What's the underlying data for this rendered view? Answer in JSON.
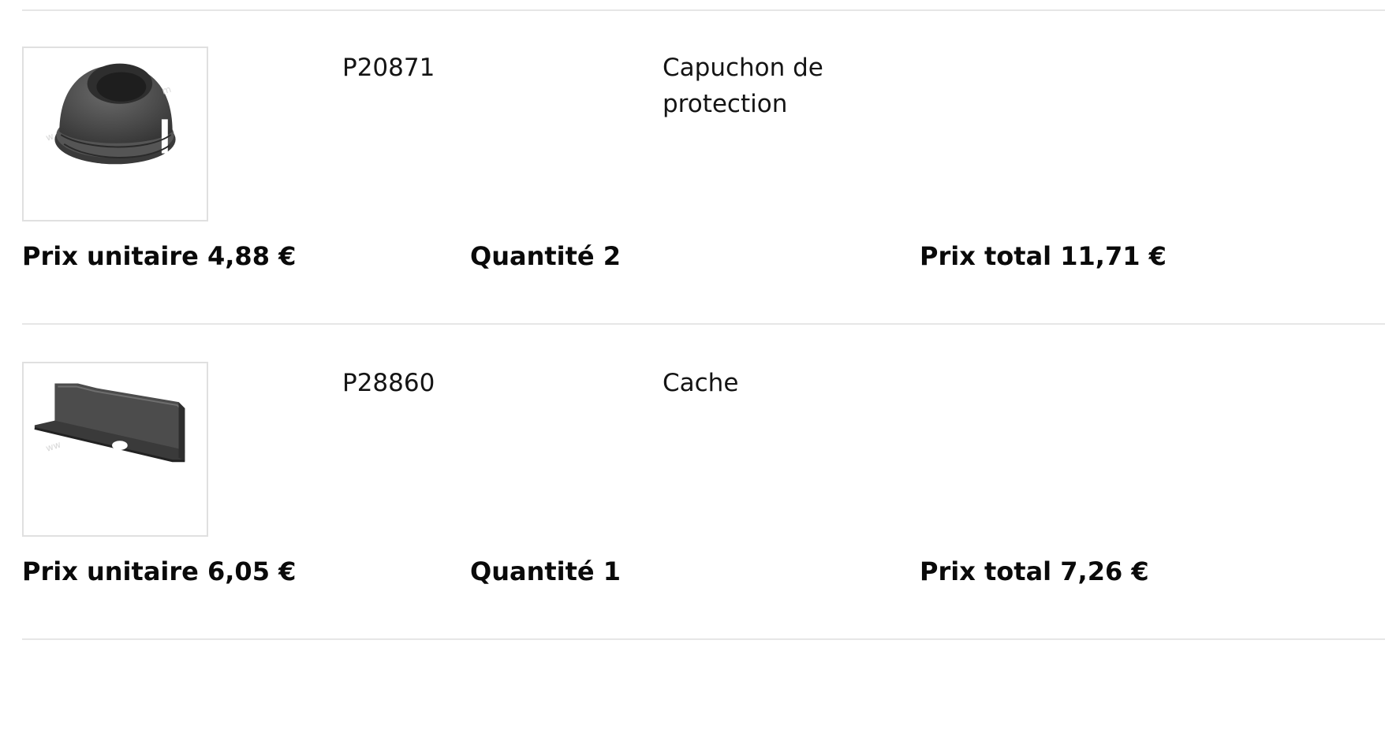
{
  "items": [
    {
      "reference": "P20871",
      "description": "Capuchon de protection",
      "image_icon": "protective-cap-image",
      "unit_price_text": "Prix unitaire 4,88 €",
      "quantity_text": "Quantité 2",
      "total_price_text": "Prix total 11,71 €"
    },
    {
      "reference": "P28860",
      "description": "Cache",
      "image_icon": "cover-plate-image",
      "unit_price_text": "Prix unitaire 6,05 €",
      "quantity_text": "Quantité 1",
      "total_price_text": "Prix total 7,26 €"
    }
  ],
  "colors": {
    "divider": "#e6e6e6",
    "thumbnail_border": "#e0e0e0",
    "text": "#111111"
  }
}
